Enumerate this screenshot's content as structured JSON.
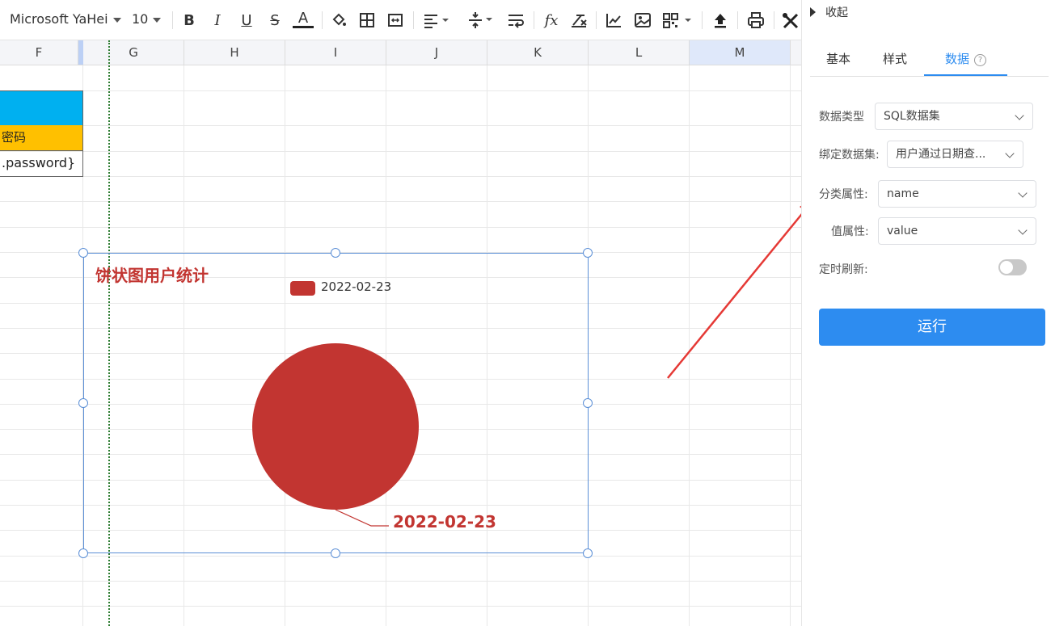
{
  "toolbar": {
    "font_family": "Microsoft YaHei",
    "font_size": "10",
    "icons": [
      "bold-icon",
      "italic-icon",
      "underline-icon",
      "strikethrough-icon",
      "font-color-icon",
      "fill-color-icon",
      "border-icon",
      "merge-cells-icon",
      "align-left-icon",
      "valign-icon",
      "wrap-text-icon",
      "function-icon",
      "clear-format-icon",
      "chart-icon",
      "image-icon",
      "qrcode-icon",
      "upload-icon",
      "print-icon",
      "tools-icon"
    ]
  },
  "columns": [
    "F",
    "G",
    "H",
    "I",
    "J",
    "K",
    "L",
    "M"
  ],
  "sheet": {
    "cell_password_header": "密码",
    "cell_password_value": ".password}",
    "colors": {
      "header_blue": "#00b0f0",
      "header_yellow": "#ffc000"
    }
  },
  "chart_data": {
    "type": "pie",
    "title": "饼状图用户统计",
    "legend": [
      "2022-02-23"
    ],
    "series": [
      {
        "values": [
          1
        ],
        "categories": [
          "2022-02-23"
        ]
      }
    ],
    "slice_labels": [
      "2022-02-23"
    ],
    "legend_placement": "top-center",
    "colors": [
      "#c23531"
    ]
  },
  "panel": {
    "collapse_label": "收起",
    "tabs": [
      {
        "label": "基本"
      },
      {
        "label": "样式"
      },
      {
        "label": "数据"
      }
    ],
    "active_tab": "数据",
    "fields": {
      "data_type_label": "数据类型",
      "data_type_value": "SQL数据集",
      "dataset_label": "绑定数据集:",
      "dataset_value": "用户通过日期查...",
      "category_label": "分类属性:",
      "category_value": "name",
      "value_label": "值属性:",
      "value_value": "value",
      "refresh_label": "定时刷新:"
    },
    "run_label": "运行",
    "colors": {
      "accent": "#2d8cf0"
    }
  }
}
